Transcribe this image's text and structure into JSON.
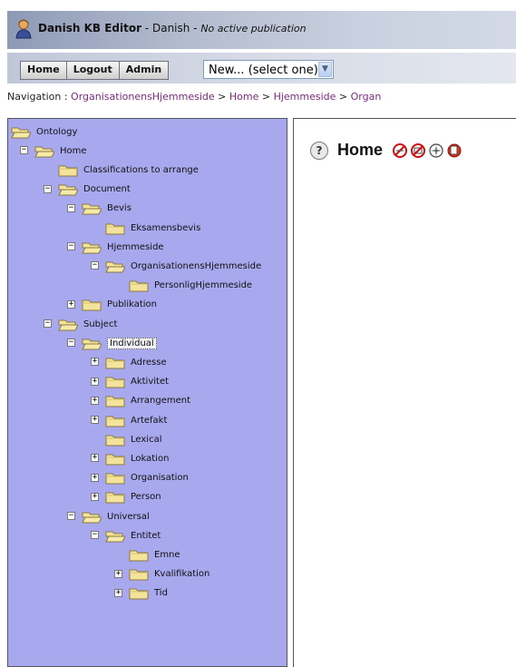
{
  "header": {
    "app_name": "Danish KB Editor",
    "separator1": " - ",
    "language": "Danish",
    "separator2": " - ",
    "status": "No active publication"
  },
  "toolbar": {
    "home_label": "Home",
    "logout_label": "Logout",
    "admin_label": "Admin",
    "new_select_value": "New... (select one)"
  },
  "navigation": {
    "label": "Navigation :",
    "crumbs": [
      "OrganisationensHjemmeside",
      "Home",
      "Hjemmeside",
      "Organ"
    ]
  },
  "main": {
    "title": "Home",
    "tool_icons": [
      "cancel-icon",
      "delete-icon",
      "settings-icon",
      "add-icon"
    ]
  },
  "tree": [
    {
      "label": "Ontology",
      "depth": 0,
      "toggle": "none",
      "open": true
    },
    {
      "label": "Home",
      "depth": 1,
      "toggle": "minus",
      "open": true
    },
    {
      "label": "Classifications to arrange",
      "depth": 2,
      "toggle": "none",
      "open": false
    },
    {
      "label": "Document",
      "depth": 2,
      "toggle": "minus",
      "open": true
    },
    {
      "label": "Bevis",
      "depth": 3,
      "toggle": "minus",
      "open": true
    },
    {
      "label": "Eksamensbevis",
      "depth": 4,
      "toggle": "none",
      "open": false
    },
    {
      "label": "Hjemmeside",
      "depth": 3,
      "toggle": "minus",
      "open": true
    },
    {
      "label": "OrganisationensHjemmeside",
      "depth": 4,
      "toggle": "minus",
      "open": true
    },
    {
      "label": "PersonligHjemmeside",
      "depth": 5,
      "toggle": "none",
      "open": false
    },
    {
      "label": "Publikation",
      "depth": 3,
      "toggle": "plus",
      "open": false
    },
    {
      "label": "Subject",
      "depth": 2,
      "toggle": "minus",
      "open": true
    },
    {
      "label": "Individual",
      "depth": 3,
      "toggle": "minus",
      "open": true,
      "selected": true
    },
    {
      "label": "Adresse",
      "depth": 4,
      "toggle": "plus",
      "open": false
    },
    {
      "label": "Aktivitet",
      "depth": 4,
      "toggle": "plus",
      "open": false
    },
    {
      "label": "Arrangement",
      "depth": 4,
      "toggle": "plus",
      "open": false
    },
    {
      "label": "Artefakt",
      "depth": 4,
      "toggle": "plus",
      "open": false
    },
    {
      "label": "Lexical",
      "depth": 4,
      "toggle": "none",
      "open": false
    },
    {
      "label": "Lokation",
      "depth": 4,
      "toggle": "plus",
      "open": false
    },
    {
      "label": "Organisation",
      "depth": 4,
      "toggle": "plus",
      "open": false
    },
    {
      "label": "Person",
      "depth": 4,
      "toggle": "plus",
      "open": false
    },
    {
      "label": "Universal",
      "depth": 3,
      "toggle": "minus",
      "open": true
    },
    {
      "label": "Entitet",
      "depth": 4,
      "toggle": "minus",
      "open": true
    },
    {
      "label": "Emne",
      "depth": 5,
      "toggle": "none",
      "open": false
    },
    {
      "label": "Kvalifikation",
      "depth": 5,
      "toggle": "plus",
      "open": false
    },
    {
      "label": "Tid",
      "depth": 5,
      "toggle": "plus",
      "open": false
    }
  ]
}
